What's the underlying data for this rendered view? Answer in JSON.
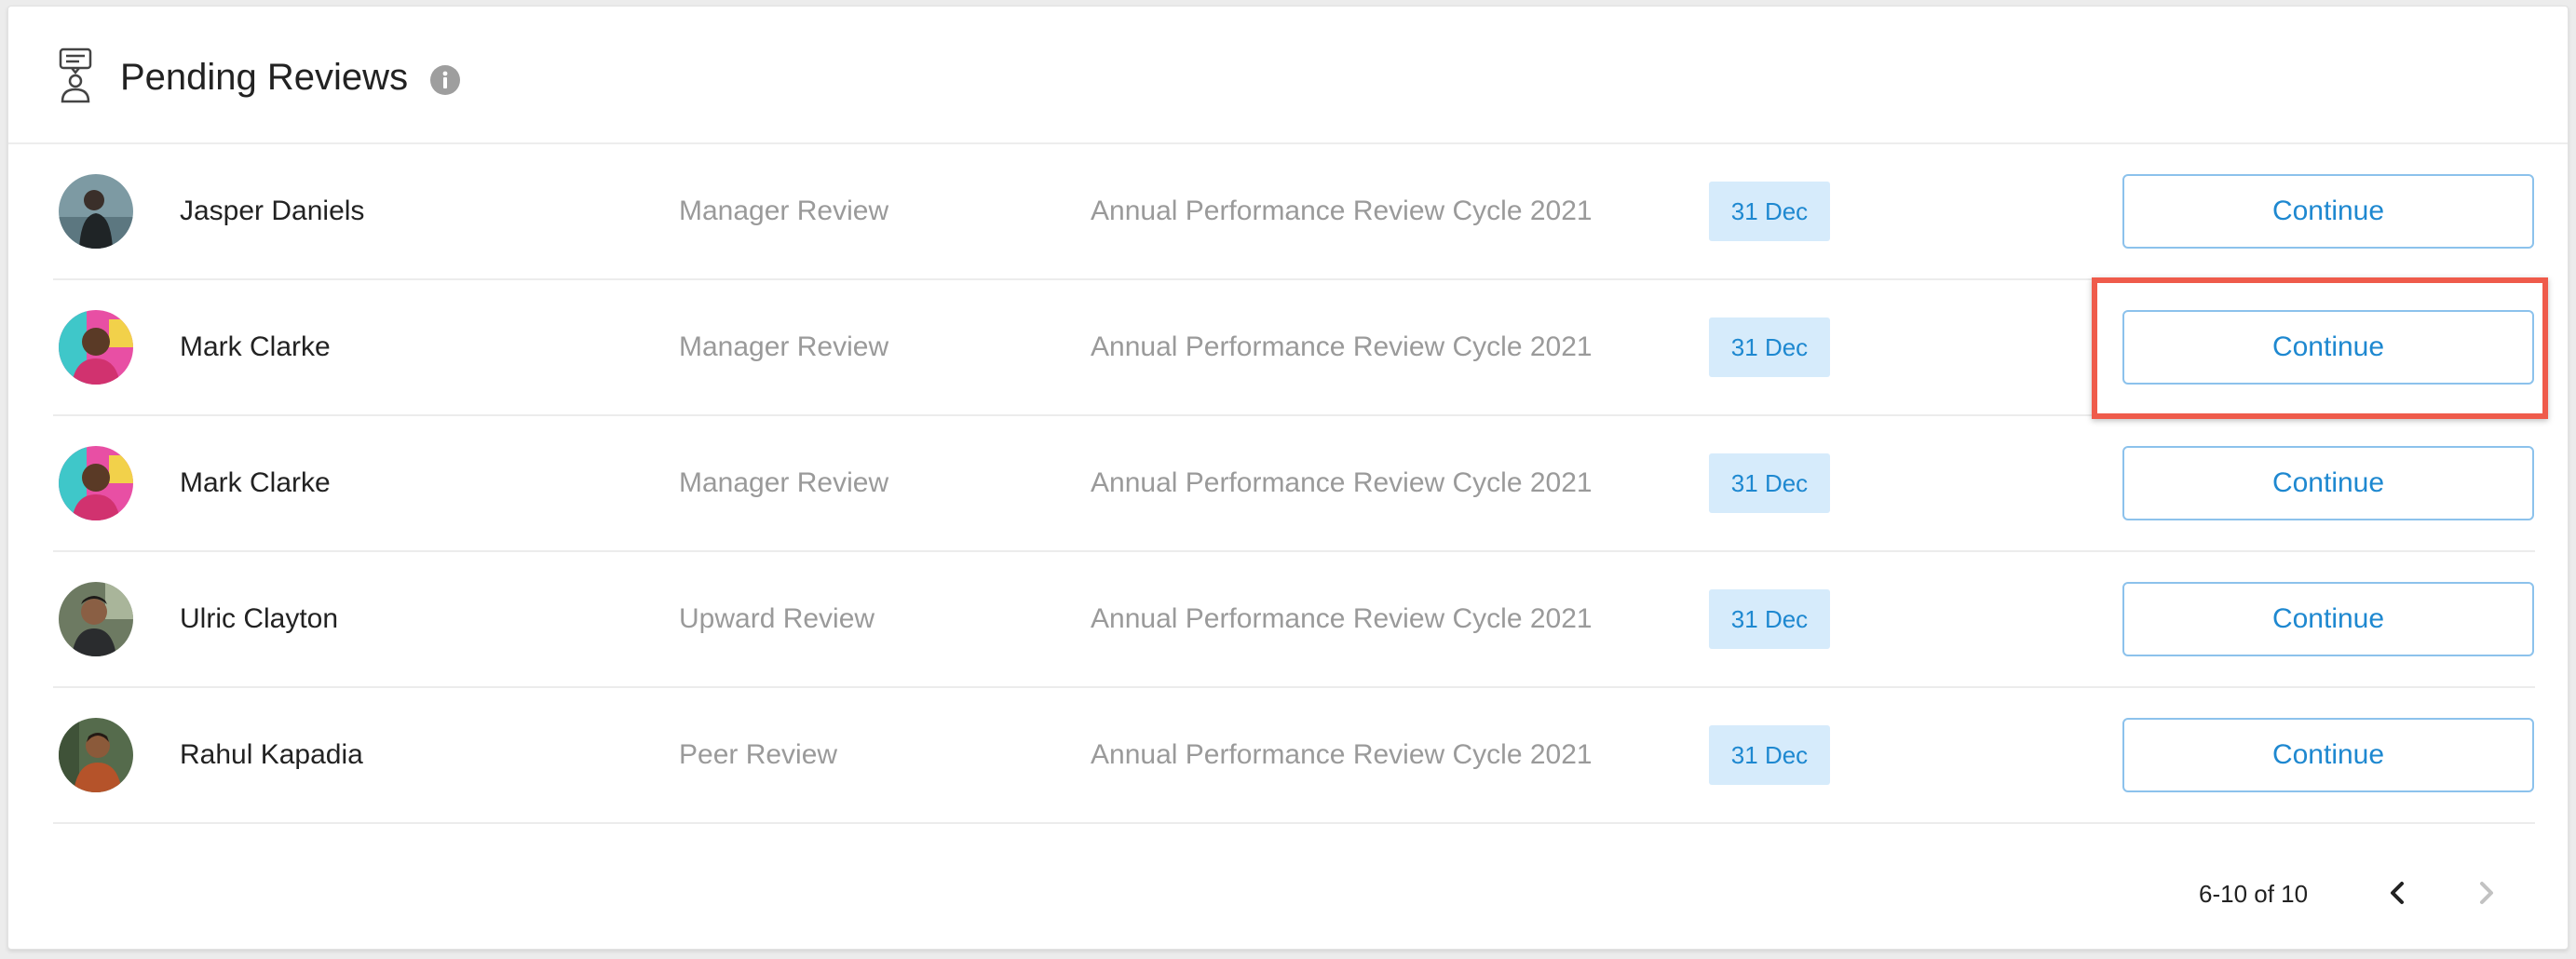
{
  "panel": {
    "title": "Pending Reviews",
    "header_icon": "review-document-person-icon",
    "info_icon": "info-icon"
  },
  "reviews": [
    {
      "name": "Jasper Daniels",
      "review_type": "Manager Review",
      "cycle": "Annual Performance Review Cycle 2021",
      "due": "31 Dec",
      "action": "Continue",
      "avatar": "avatar-photo"
    },
    {
      "name": "Mark Clarke",
      "review_type": "Manager Review",
      "cycle": "Annual Performance Review Cycle 2021",
      "due": "31 Dec",
      "action": "Continue",
      "avatar": "avatar-photo"
    },
    {
      "name": "Mark Clarke",
      "review_type": "Manager Review",
      "cycle": "Annual Performance Review Cycle 2021",
      "due": "31 Dec",
      "action": "Continue",
      "avatar": "avatar-photo"
    },
    {
      "name": "Ulric Clayton",
      "review_type": "Upward Review",
      "cycle": "Annual Performance Review Cycle 2021",
      "due": "31 Dec",
      "action": "Continue",
      "avatar": "avatar-photo"
    },
    {
      "name": "Rahul Kapadia",
      "review_type": "Peer Review",
      "cycle": "Annual Performance Review Cycle 2021",
      "due": "31 Dec",
      "action": "Continue",
      "avatar": "avatar-photo"
    }
  ],
  "pagination": {
    "range_text": "6-10 of 10",
    "prev_icon": "chevron-left-icon",
    "next_icon": "chevron-right-icon"
  },
  "colors": {
    "accent": "#1e88d0",
    "badge_bg": "#d6ebfb",
    "button_border": "#8cc2ec",
    "highlight": "#ef5b4b"
  }
}
